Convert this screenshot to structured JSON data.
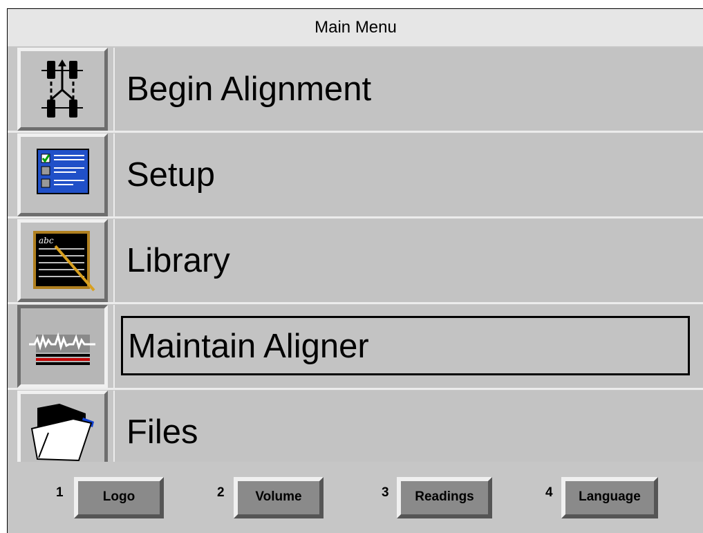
{
  "window": {
    "title": "Main Menu"
  },
  "menu": {
    "items": [
      {
        "label": "Begin Alignment",
        "icon": "wheel-alignment-icon",
        "selected": false
      },
      {
        "label": "Setup",
        "icon": "checklist-icon",
        "selected": false
      },
      {
        "label": "Library",
        "icon": "chalkboard-icon",
        "selected": false
      },
      {
        "label": "Maintain Aligner",
        "icon": "waveform-icon",
        "selected": true
      },
      {
        "label": "Files",
        "icon": "folder-icon",
        "selected": false
      }
    ]
  },
  "function_keys": [
    {
      "number": "1",
      "label": "Logo"
    },
    {
      "number": "2",
      "label": "Volume"
    },
    {
      "number": "3",
      "label": "Readings"
    },
    {
      "number": "4",
      "label": "Language"
    }
  ],
  "colors": {
    "background": "#c6c6c6",
    "title_bar": "#e6e6e6",
    "function_key": "#8a8a8a",
    "setup_icon_blue": "#2050c8"
  }
}
